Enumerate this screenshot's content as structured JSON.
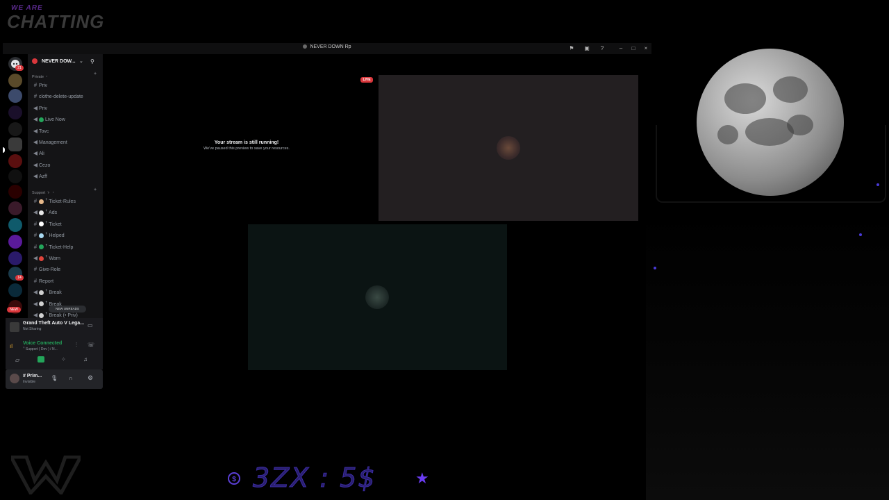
{
  "overlay": {
    "brand_line1": "WE ARE",
    "brand_line2": "CHATTING",
    "price_text": "3ZX : 5$",
    "coin_symbol": "$"
  },
  "window": {
    "title": "NEVER DOWN Rp"
  },
  "server_rail": {
    "top_badge": "21",
    "badge_2": "14",
    "new_label": "NEW"
  },
  "guild": {
    "name": "NEVER DOW...",
    "categories": [
      {
        "label": "Private ・"
      },
      {
        "label": "Support ゝ ・"
      }
    ],
    "private_channels": [
      {
        "type": "text",
        "label": "Priv"
      },
      {
        "type": "text",
        "label": "clothe-delete-update"
      },
      {
        "type": "voice",
        "label": "Priv"
      },
      {
        "type": "voice",
        "label": "Live Now",
        "emoji_color": "#23a55a"
      },
      {
        "type": "voice",
        "label": "Tovc"
      },
      {
        "type": "voice",
        "label": "Management"
      },
      {
        "type": "voice",
        "label": "Ali"
      },
      {
        "type": "voice",
        "label": "Cezo"
      },
      {
        "type": "voice",
        "label": "Azff"
      }
    ],
    "support_channels": [
      {
        "type": "text",
        "label": "ꜛ Ticket-Rules",
        "emoji_color": "#e6b88a"
      },
      {
        "type": "voice",
        "label": "ꜛ Ads",
        "emoji_color": "#e8e8e8"
      },
      {
        "type": "text",
        "label": "ꜛ Ticket",
        "emoji_color": "#ffffff"
      },
      {
        "type": "text",
        "label": "ꜛ Helped",
        "emoji_color": "#a8d8f0"
      },
      {
        "type": "text",
        "label": "ꜛ Ticket-Help",
        "emoji_color": "#23a55a"
      },
      {
        "type": "voice",
        "label": "ꜛ Warn",
        "emoji_color": "#e0443b"
      },
      {
        "type": "text",
        "label": "Give-Role"
      },
      {
        "type": "text",
        "label": "Report"
      },
      {
        "type": "voice",
        "label": "ꜛ Break",
        "emoji_color": "#d0d0d0"
      },
      {
        "type": "voice",
        "label": "ꜛ Break",
        "emoji_color": "#d0d0d0"
      },
      {
        "type": "voice",
        "label": "ꜛ Break (• Priv)",
        "emoji_color": "#d0d0d0"
      }
    ],
    "new_unreads": "NEW UNREADS"
  },
  "activity": {
    "game": "Grand Theft Auto V Lega...",
    "status": "Not Sharing"
  },
  "voice": {
    "status": "Voice Connected",
    "channel": "ꜛ Support ( Dev ) / N..."
  },
  "user": {
    "name": "# Prim...",
    "status": "Invisible"
  },
  "stage": {
    "stream_title": "Your stream is still running!",
    "stream_sub": "We've paused this preview to save your resources.",
    "live_badge": "LIVE"
  },
  "colors": {
    "accent": "#5b3fd6",
    "live_red": "#da373c",
    "voice_green": "#23a55a",
    "panel_bg": "#141416"
  }
}
